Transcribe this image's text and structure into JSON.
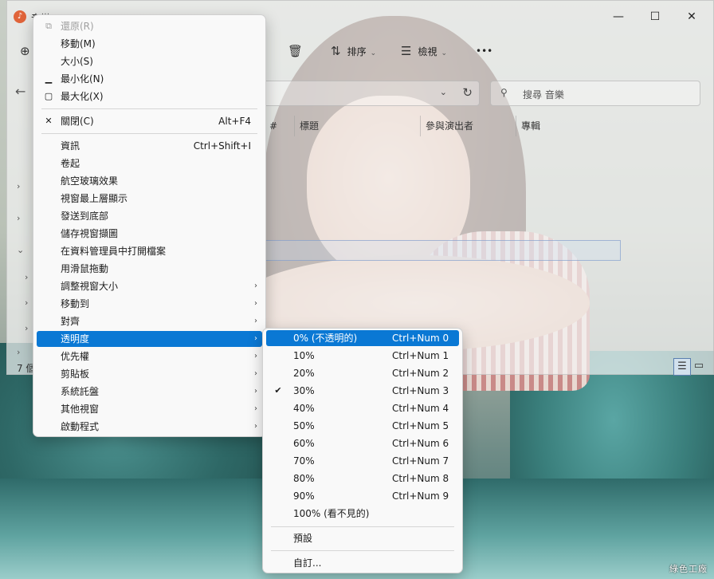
{
  "window": {
    "title": "音樂",
    "app_icon": "♪",
    "controls": {
      "minimize": "—",
      "maximize": "☐",
      "close": "✕"
    }
  },
  "toolbar": {
    "new_icon": "⊕",
    "delete_icon": "🗑",
    "sort_label": "排序",
    "view_label": "檢視",
    "more": "•••"
  },
  "address": {
    "search_placeholder": "搜尋 音樂"
  },
  "columns": [
    "#",
    "標題",
    "參與演出者",
    "專輯"
  ],
  "status": {
    "item_count": "7 個"
  },
  "system_menu": {
    "items": [
      {
        "label": "還原(R)",
        "shortcut": "",
        "glyph": "restore-icon",
        "disabled": true
      },
      {
        "label": "移動(M)",
        "shortcut": ""
      },
      {
        "label": "大小(S)",
        "shortcut": ""
      },
      {
        "label": "最小化(N)",
        "shortcut": "",
        "glyph": "minimize-icon"
      },
      {
        "label": "最大化(X)",
        "shortcut": "",
        "glyph": "maximize-icon"
      },
      {
        "label": "關閉(C)",
        "shortcut": "Alt+F4",
        "glyph": "close-icon"
      },
      {
        "label": "資訊",
        "shortcut": "Ctrl+Shift+I"
      },
      {
        "label": "卷起",
        "shortcut": ""
      },
      {
        "label": "航空玻璃效果",
        "shortcut": ""
      },
      {
        "label": "視窗最上層顯示",
        "shortcut": ""
      },
      {
        "label": "發送到底部",
        "shortcut": ""
      },
      {
        "label": "儲存視窗擷圖",
        "shortcut": ""
      },
      {
        "label": "在資料管理員中打開檔案",
        "shortcut": ""
      },
      {
        "label": "用滑鼠拖動",
        "shortcut": ""
      },
      {
        "label": "調整視窗大小",
        "submenu": true
      },
      {
        "label": "移動到",
        "submenu": true
      },
      {
        "label": "對齊",
        "submenu": true
      },
      {
        "label": "透明度",
        "submenu": true,
        "highlighted": true
      },
      {
        "label": "优先權",
        "submenu": true
      },
      {
        "label": "剪貼板",
        "submenu": true
      },
      {
        "label": "系統託盤",
        "submenu": true
      },
      {
        "label": "其他視窗",
        "submenu": true
      },
      {
        "label": "啟動程式",
        "submenu": true
      }
    ]
  },
  "transparency_menu": {
    "items": [
      {
        "label": "0% (不透明的)",
        "shortcut": "Ctrl+Num 0",
        "highlighted": true
      },
      {
        "label": "10%",
        "shortcut": "Ctrl+Num 1"
      },
      {
        "label": "20%",
        "shortcut": "Ctrl+Num 2"
      },
      {
        "label": "30%",
        "shortcut": "Ctrl+Num 3",
        "checked": true
      },
      {
        "label": "40%",
        "shortcut": "Ctrl+Num 4"
      },
      {
        "label": "50%",
        "shortcut": "Ctrl+Num 5"
      },
      {
        "label": "60%",
        "shortcut": "Ctrl+Num 6"
      },
      {
        "label": "70%",
        "shortcut": "Ctrl+Num 7"
      },
      {
        "label": "80%",
        "shortcut": "Ctrl+Num 8"
      },
      {
        "label": "90%",
        "shortcut": "Ctrl+Num 9"
      },
      {
        "label": "100% (看不見的)",
        "shortcut": ""
      },
      {
        "label": "預設",
        "shortcut": ""
      },
      {
        "label": "自訂...",
        "shortcut": ""
      }
    ],
    "checkmark": "✔"
  },
  "watermark": "綠色工廠",
  "colors": {
    "highlight": "#0a78d4",
    "menu_bg": "#f9f9f9"
  }
}
